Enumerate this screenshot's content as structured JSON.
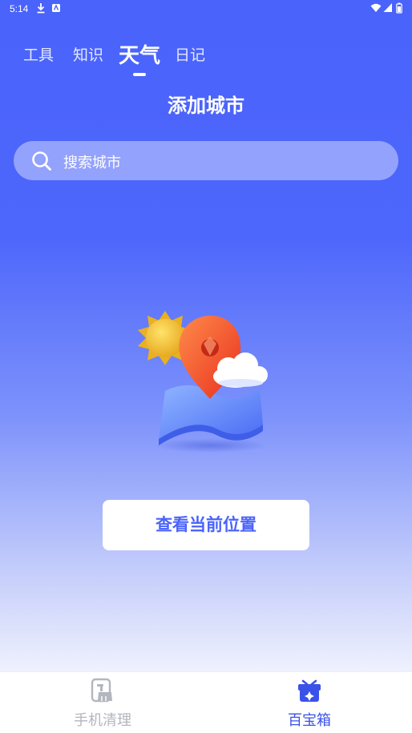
{
  "status_bar": {
    "time": "5:14"
  },
  "tabs": [
    {
      "label": "工具",
      "active": false
    },
    {
      "label": "知识",
      "active": false
    },
    {
      "label": "天气",
      "active": true
    },
    {
      "label": "日记",
      "active": false
    }
  ],
  "page": {
    "title": "添加城市"
  },
  "search": {
    "placeholder": "搜索城市",
    "icon": "search-icon"
  },
  "illustration": {
    "description_icon": "location-weather-illustration"
  },
  "locate_button": {
    "label": "查看当前位置"
  },
  "bottom_nav": {
    "items": [
      {
        "label": "手机清理",
        "icon": "phone-clean-icon",
        "active": false
      },
      {
        "label": "百宝箱",
        "icon": "treasure-box-icon",
        "active": true
      }
    ]
  },
  "colors": {
    "primary": "#4a63fb",
    "nav_active": "#3b52e8",
    "nav_inactive": "#b3b6bf"
  }
}
